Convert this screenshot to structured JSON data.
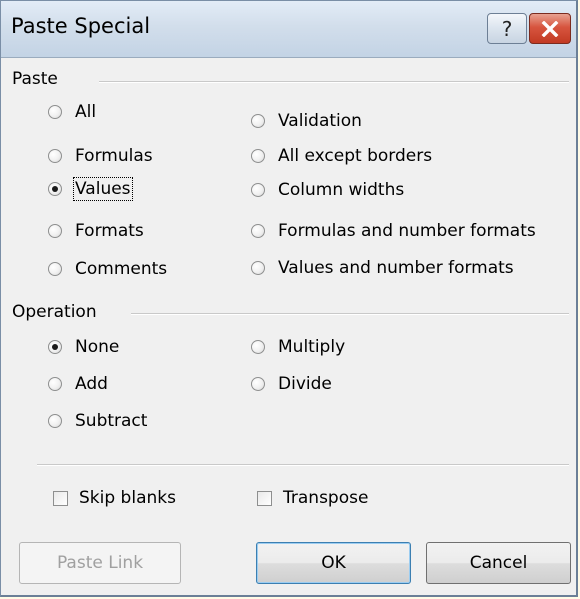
{
  "window": {
    "title": "Paste Special",
    "help_label": "?",
    "close_icon": "close-x-icon",
    "close_color": "#c23a23"
  },
  "paste": {
    "label": "Paste",
    "options_left": [
      "All",
      "Formulas",
      "Values",
      "Formats",
      "Comments"
    ],
    "options_right": [
      "Validation",
      "All except borders",
      "Column widths",
      "Formulas and number formats",
      "Values and number formats"
    ],
    "selected": "Values"
  },
  "operation": {
    "label": "Operation",
    "options_left": [
      "None",
      "Add",
      "Subtract"
    ],
    "options_right": [
      "Multiply",
      "Divide"
    ],
    "selected": "None"
  },
  "checkboxes": {
    "skip_blanks": {
      "label": "Skip blanks",
      "checked": false
    },
    "transpose": {
      "label": "Transpose",
      "checked": false
    }
  },
  "buttons": {
    "paste_link": "Paste Link",
    "ok": "OK",
    "cancel": "Cancel"
  }
}
